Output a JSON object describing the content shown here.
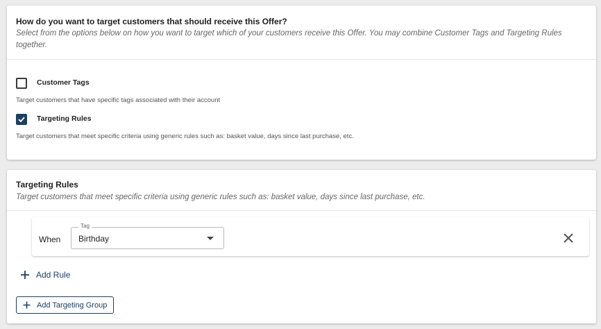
{
  "targeting_options": {
    "title": "How do you want to target customers that should receive this Offer?",
    "subtitle": "Select from the options below on how you want to target which of your customers receive this Offer. You may combine Customer Tags and Targeting Rules together.",
    "options": [
      {
        "label": "Customer Tags",
        "description": "Target customers that have specific tags associated with their account",
        "checked": false
      },
      {
        "label": "Targeting Rules",
        "description": "Target customers that meet specific criteria using generic rules such as: basket value, days since last purchase, etc.",
        "checked": true
      }
    ]
  },
  "targeting_rules": {
    "title": "Targeting Rules",
    "subtitle": "Target customers that meet specific criteria using generic rules such as: basket value, days since last purchase, etc.",
    "rule": {
      "when_label": "When",
      "field_legend": "Tag",
      "field_value": "Birthday"
    },
    "add_rule_label": "Add Rule",
    "add_group_label": "Add Targeting Group"
  },
  "colors": {
    "accent": "#1b3f63",
    "page_background": "#ececec",
    "card_background": "#ffffff"
  }
}
